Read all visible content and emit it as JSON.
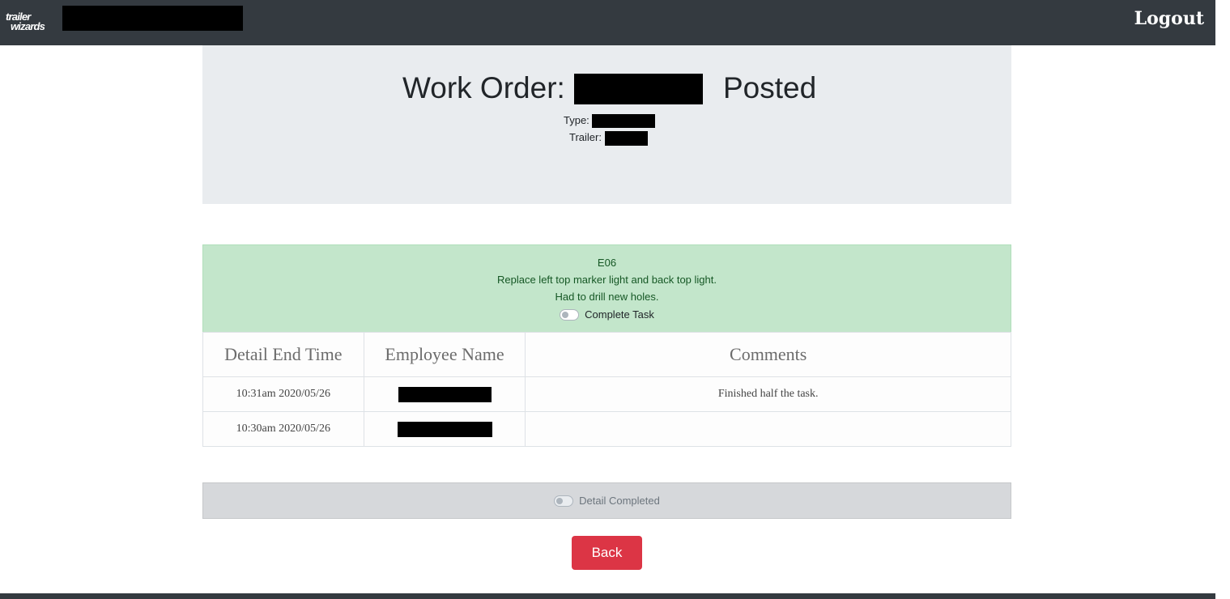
{
  "navbar": {
    "brand_line1": "trailer",
    "brand_line2": "wizards",
    "logout_label": "Logout"
  },
  "work_order": {
    "label": "Work Order:",
    "status": "Posted",
    "type_label": "Type:",
    "trailer_label": "Trailer:"
  },
  "task": {
    "code": "E06",
    "description": "Replace left top marker light and back top light.",
    "note": "Had to drill new holes.",
    "complete_toggle_label": "Complete Task",
    "complete_toggle_on": false
  },
  "details_table": {
    "headers": [
      "Detail End Time",
      "Employee Name",
      "Comments"
    ],
    "rows": [
      {
        "end_time": "10:31am 2020/05/26",
        "comments": "Finished half the task."
      },
      {
        "end_time": "10:30am 2020/05/26",
        "comments": ""
      }
    ]
  },
  "detail_completed": {
    "label": "Detail Completed",
    "on": false
  },
  "back_button_label": "Back",
  "colors": {
    "navbar": "#343a40",
    "jumbotron": "#e9ecef",
    "task_success_bg": "#c3e6cb",
    "task_success_text": "#155724",
    "detail_completed_bg": "#d6d8db",
    "back_button": "#dc3545"
  }
}
